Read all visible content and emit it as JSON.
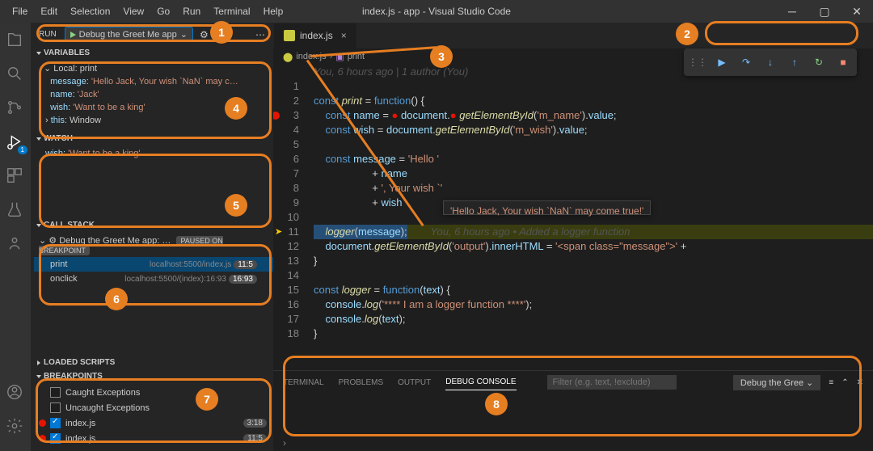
{
  "title": "index.js - app - Visual Studio Code",
  "menubar": {
    "file": "File",
    "edit": "Edit",
    "selection": "Selection",
    "view": "View",
    "go": "Go",
    "run": "Run",
    "terminal": "Terminal",
    "help": "Help"
  },
  "run_header": {
    "label": "RUN",
    "config": "Debug the Greet Me app",
    "chev": "⌄"
  },
  "activity_badge": "1",
  "sections": {
    "variables": "VARIABLES",
    "watch": "WATCH",
    "callstack": "CALL STACK",
    "loaded": "LOADED SCRIPTS",
    "breakpoints": "BREAKPOINTS"
  },
  "variables": {
    "scope": "Local: print",
    "items": [
      {
        "k": "message:",
        "v": "'Hello Jack, Your wish `NaN` may c…"
      },
      {
        "k": "name:",
        "v": "'Jack'"
      },
      {
        "k": "wish:",
        "v": "'Want to be a king'"
      },
      {
        "k": "this:",
        "v": "Window",
        "expandable": true
      }
    ]
  },
  "watch": {
    "items": [
      {
        "k": "wish:",
        "v": "'Want to be a king'"
      }
    ]
  },
  "callstack": {
    "session": "Debug the Greet Me app: …",
    "paused": "PAUSED ON BREAKPOINT",
    "frames": [
      {
        "name": "print",
        "loc": "localhost:5500/index.js",
        "ln": "11:5"
      },
      {
        "name": "onclick",
        "loc": "localhost:5500/(index):16:93",
        "ln": "16:93"
      }
    ]
  },
  "breakpoints": {
    "caught": "Caught Exceptions",
    "uncaught": "Uncaught Exceptions",
    "items": [
      {
        "file": "index.js",
        "ln": "3:18"
      },
      {
        "file": "index.js",
        "ln": "11:5"
      }
    ]
  },
  "tab": {
    "name": "index.js",
    "close": "×"
  },
  "breadcrumb": {
    "file": "index.js",
    "sym": "print"
  },
  "gitlens": "You, 6 hours ago | 1 author (You)",
  "gitlens_inline": "You, 6 hours ago • Added a logger function",
  "code": {
    "lines": [
      "1",
      "2",
      "3",
      "4",
      "5",
      "6",
      "7",
      "8",
      "9",
      "10",
      "11",
      "12",
      "13",
      "14",
      "15",
      "16",
      "17",
      "18"
    ]
  },
  "debug_hover": "'Hello Jack, Your wish `NaN` may come true!'",
  "panel": {
    "tabs": {
      "terminal": "TERMINAL",
      "problems": "PROBLEMS",
      "output": "OUTPUT",
      "debug": "DEBUG CONSOLE"
    },
    "filter_ph": "Filter (e.g. text, !exclude)",
    "dropdown": "Debug the Gree ⌄"
  },
  "annotations": {
    "n1": "1",
    "n2": "2",
    "n3": "3",
    "n4": "4",
    "n5": "5",
    "n6": "6",
    "n7": "7",
    "n8": "8"
  }
}
